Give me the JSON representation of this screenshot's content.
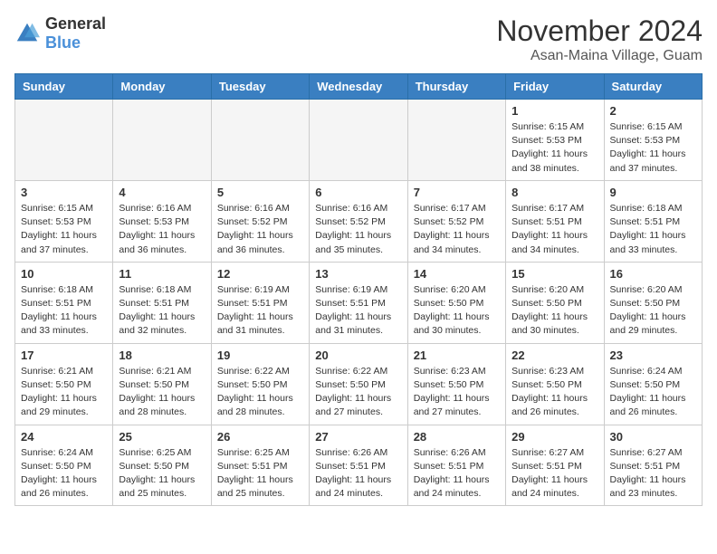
{
  "logo": {
    "general": "General",
    "blue": "Blue"
  },
  "title": "November 2024",
  "location": "Asan-Maina Village, Guam",
  "days_of_week": [
    "Sunday",
    "Monday",
    "Tuesday",
    "Wednesday",
    "Thursday",
    "Friday",
    "Saturday"
  ],
  "weeks": [
    [
      {
        "day": "",
        "empty": true
      },
      {
        "day": "",
        "empty": true
      },
      {
        "day": "",
        "empty": true
      },
      {
        "day": "",
        "empty": true
      },
      {
        "day": "",
        "empty": true
      },
      {
        "day": "1",
        "sunrise": "6:15 AM",
        "sunset": "5:53 PM",
        "daylight": "11 hours and 38 minutes."
      },
      {
        "day": "2",
        "sunrise": "6:15 AM",
        "sunset": "5:53 PM",
        "daylight": "11 hours and 37 minutes."
      }
    ],
    [
      {
        "day": "3",
        "sunrise": "6:15 AM",
        "sunset": "5:53 PM",
        "daylight": "11 hours and 37 minutes."
      },
      {
        "day": "4",
        "sunrise": "6:16 AM",
        "sunset": "5:53 PM",
        "daylight": "11 hours and 36 minutes."
      },
      {
        "day": "5",
        "sunrise": "6:16 AM",
        "sunset": "5:52 PM",
        "daylight": "11 hours and 36 minutes."
      },
      {
        "day": "6",
        "sunrise": "6:16 AM",
        "sunset": "5:52 PM",
        "daylight": "11 hours and 35 minutes."
      },
      {
        "day": "7",
        "sunrise": "6:17 AM",
        "sunset": "5:52 PM",
        "daylight": "11 hours and 34 minutes."
      },
      {
        "day": "8",
        "sunrise": "6:17 AM",
        "sunset": "5:51 PM",
        "daylight": "11 hours and 34 minutes."
      },
      {
        "day": "9",
        "sunrise": "6:18 AM",
        "sunset": "5:51 PM",
        "daylight": "11 hours and 33 minutes."
      }
    ],
    [
      {
        "day": "10",
        "sunrise": "6:18 AM",
        "sunset": "5:51 PM",
        "daylight": "11 hours and 33 minutes."
      },
      {
        "day": "11",
        "sunrise": "6:18 AM",
        "sunset": "5:51 PM",
        "daylight": "11 hours and 32 minutes."
      },
      {
        "day": "12",
        "sunrise": "6:19 AM",
        "sunset": "5:51 PM",
        "daylight": "11 hours and 31 minutes."
      },
      {
        "day": "13",
        "sunrise": "6:19 AM",
        "sunset": "5:51 PM",
        "daylight": "11 hours and 31 minutes."
      },
      {
        "day": "14",
        "sunrise": "6:20 AM",
        "sunset": "5:50 PM",
        "daylight": "11 hours and 30 minutes."
      },
      {
        "day": "15",
        "sunrise": "6:20 AM",
        "sunset": "5:50 PM",
        "daylight": "11 hours and 30 minutes."
      },
      {
        "day": "16",
        "sunrise": "6:20 AM",
        "sunset": "5:50 PM",
        "daylight": "11 hours and 29 minutes."
      }
    ],
    [
      {
        "day": "17",
        "sunrise": "6:21 AM",
        "sunset": "5:50 PM",
        "daylight": "11 hours and 29 minutes."
      },
      {
        "day": "18",
        "sunrise": "6:21 AM",
        "sunset": "5:50 PM",
        "daylight": "11 hours and 28 minutes."
      },
      {
        "day": "19",
        "sunrise": "6:22 AM",
        "sunset": "5:50 PM",
        "daylight": "11 hours and 28 minutes."
      },
      {
        "day": "20",
        "sunrise": "6:22 AM",
        "sunset": "5:50 PM",
        "daylight": "11 hours and 27 minutes."
      },
      {
        "day": "21",
        "sunrise": "6:23 AM",
        "sunset": "5:50 PM",
        "daylight": "11 hours and 27 minutes."
      },
      {
        "day": "22",
        "sunrise": "6:23 AM",
        "sunset": "5:50 PM",
        "daylight": "11 hours and 26 minutes."
      },
      {
        "day": "23",
        "sunrise": "6:24 AM",
        "sunset": "5:50 PM",
        "daylight": "11 hours and 26 minutes."
      }
    ],
    [
      {
        "day": "24",
        "sunrise": "6:24 AM",
        "sunset": "5:50 PM",
        "daylight": "11 hours and 26 minutes."
      },
      {
        "day": "25",
        "sunrise": "6:25 AM",
        "sunset": "5:50 PM",
        "daylight": "11 hours and 25 minutes."
      },
      {
        "day": "26",
        "sunrise": "6:25 AM",
        "sunset": "5:51 PM",
        "daylight": "11 hours and 25 minutes."
      },
      {
        "day": "27",
        "sunrise": "6:26 AM",
        "sunset": "5:51 PM",
        "daylight": "11 hours and 24 minutes."
      },
      {
        "day": "28",
        "sunrise": "6:26 AM",
        "sunset": "5:51 PM",
        "daylight": "11 hours and 24 minutes."
      },
      {
        "day": "29",
        "sunrise": "6:27 AM",
        "sunset": "5:51 PM",
        "daylight": "11 hours and 24 minutes."
      },
      {
        "day": "30",
        "sunrise": "6:27 AM",
        "sunset": "5:51 PM",
        "daylight": "11 hours and 23 minutes."
      }
    ]
  ]
}
